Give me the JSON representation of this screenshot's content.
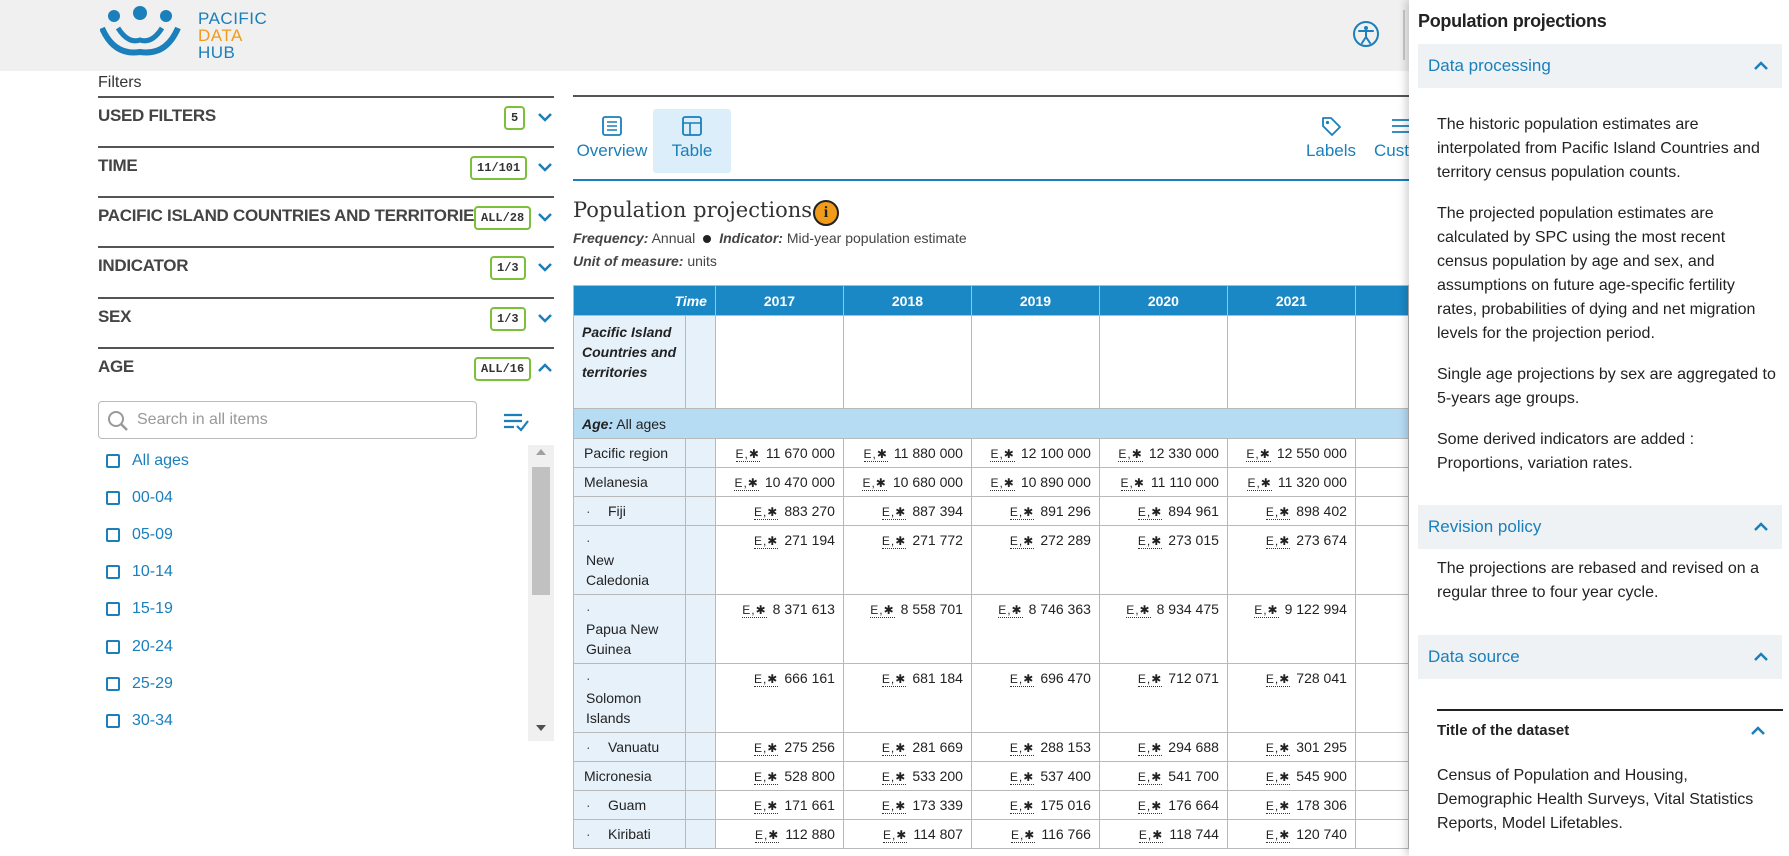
{
  "header": {
    "logo_text": [
      "PACIFIC",
      "DATA",
      "HUB"
    ],
    "logo_colors": [
      "#1a7fba",
      "#f19b1b",
      "#1a7fba"
    ]
  },
  "filters": {
    "title": "Filters",
    "rows": [
      {
        "label": "USED FILTERS",
        "badge": "5",
        "expanded": false
      },
      {
        "label": "TIME",
        "badge": "11/101",
        "expanded": false
      },
      {
        "label": "PACIFIC ISLAND COUNTRIES AND TERRITORIES",
        "badge": "ALL/28",
        "expanded": false
      },
      {
        "label": "INDICATOR",
        "badge": "1/3",
        "expanded": false
      },
      {
        "label": "SEX",
        "badge": "1/3",
        "expanded": false
      },
      {
        "label": "AGE",
        "badge": "ALL/16",
        "expanded": true
      }
    ],
    "search_placeholder": "Search in all items",
    "age_items": [
      "All ages",
      "00-04",
      "05-09",
      "10-14",
      "15-19",
      "20-24",
      "25-29",
      "30-34"
    ]
  },
  "tabs": {
    "overview": "Overview",
    "table": "Table",
    "labels": "Labels",
    "customise": "Cust"
  },
  "dataset": {
    "title": "Population projections",
    "frequency_label": "Frequency:",
    "frequency_value": "Annual",
    "indicator_label": "Indicator:",
    "indicator_value": "Mid-year population estimate",
    "unit_label": "Unit of measure:",
    "unit_value": "units"
  },
  "table": {
    "time_label": "Time",
    "years": [
      "2017",
      "2018",
      "2019",
      "2020",
      "2021"
    ],
    "dim_header": "Pacific Island Countries and territories",
    "group_label": "Age:",
    "group_value": "All ages",
    "flag": "E,✱",
    "rows": [
      {
        "name": "Pacific region",
        "child": false,
        "values": [
          "11 670 000",
          "11 880 000",
          "12 100 000",
          "12 330 000",
          "12 550 000"
        ]
      },
      {
        "name": "Melanesia",
        "child": false,
        "values": [
          "10 470 000",
          "10 680 000",
          "10 890 000",
          "11 110 000",
          "11 320 000"
        ]
      },
      {
        "name": "Fiji",
        "child": true,
        "values": [
          "883 270",
          "887 394",
          "891 296",
          "894 961",
          "898 402"
        ]
      },
      {
        "name": "New Caledonia",
        "child": true,
        "values": [
          "271 194",
          "271 772",
          "272 289",
          "273 015",
          "273 674"
        ]
      },
      {
        "name": "Papua New Guinea",
        "child": true,
        "values": [
          "8 371 613",
          "8 558 701",
          "8 746 363",
          "8 934 475",
          "9 122 994"
        ]
      },
      {
        "name": "Solomon Islands",
        "child": true,
        "values": [
          "666 161",
          "681 184",
          "696 470",
          "712 071",
          "728 041"
        ]
      },
      {
        "name": "Vanuatu",
        "child": true,
        "values": [
          "275 256",
          "281 669",
          "288 153",
          "294 688",
          "301 295"
        ]
      },
      {
        "name": "Micronesia",
        "child": false,
        "values": [
          "528 800",
          "533 200",
          "537 400",
          "541 700",
          "545 900"
        ]
      },
      {
        "name": "Guam",
        "child": true,
        "values": [
          "171 661",
          "173 339",
          "175 016",
          "176 664",
          "178 306"
        ]
      },
      {
        "name": "Kiribati",
        "child": true,
        "values": [
          "112 880",
          "114 807",
          "116 766",
          "118 744",
          "120 740"
        ]
      }
    ]
  },
  "panel": {
    "title": "Population projections",
    "data_processing": {
      "label": "Data processing",
      "paragraphs": [
        "The historic population estimates are interpolated from Pacific Island Countries and territory census population counts.",
        "The projected population estimates are calculated by SPC using the most recent census population by age and sex, and assumptions on future age-specific fertility rates, probabilities of dying and net migration levels for the projection period.",
        "Single age projections by sex are aggregated to 5-years age groups.",
        "Some derived indicators are added : Proportions, variation rates."
      ]
    },
    "revision_policy": {
      "label": "Revision policy",
      "text": "The projections are rebased and revised on a regular three to four year cycle."
    },
    "data_source": {
      "label": "Data source",
      "sub_label": "Title of the dataset",
      "text": "Census of Population and Housing, Demographic Health Surveys, Vital Statistics Reports, Model Lifetables."
    }
  },
  "colors": {
    "accent": "#1a7fba",
    "table_header": "#1a88c5",
    "badge_border": "#7cbf3b",
    "info": "#f19b1b"
  }
}
